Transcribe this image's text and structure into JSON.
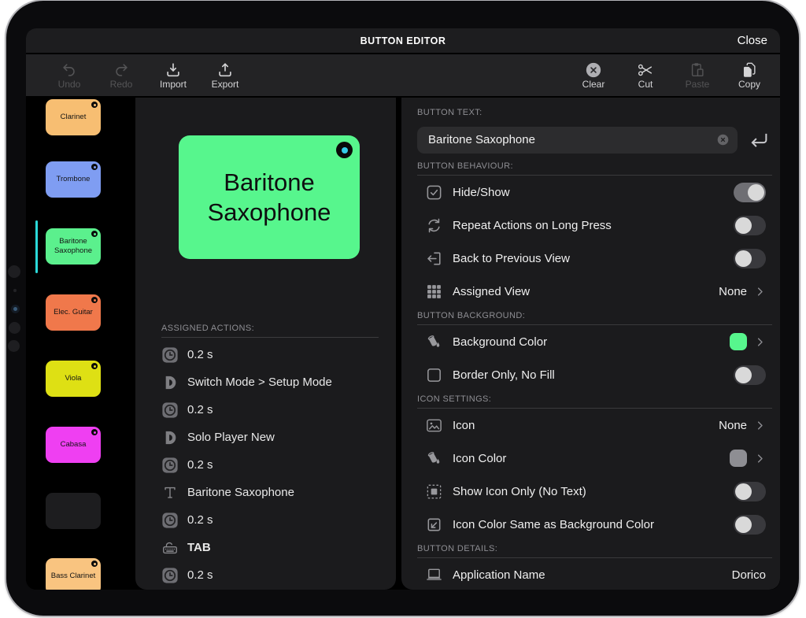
{
  "titlebar": {
    "title": "BUTTON EDITOR",
    "close_label": "Close"
  },
  "toolbar": {
    "left": [
      {
        "label": "Undo",
        "icon": "undo-icon",
        "enabled": false
      },
      {
        "label": "Redo",
        "icon": "redo-icon",
        "enabled": false
      },
      {
        "label": "Import",
        "icon": "import-icon",
        "enabled": true
      },
      {
        "label": "Export",
        "icon": "export-icon",
        "enabled": true
      }
    ],
    "right": [
      {
        "label": "Clear",
        "icon": "clear-icon",
        "enabled": true
      },
      {
        "label": "Cut",
        "icon": "cut-icon",
        "enabled": true
      },
      {
        "label": "Paste",
        "icon": "paste-icon",
        "enabled": false
      },
      {
        "label": "Copy",
        "icon": "copy-icon",
        "enabled": true
      }
    ]
  },
  "sidebar": {
    "selection_color": "#2BD9D9",
    "buttons": [
      {
        "label": "Clarinet",
        "color": "#F7BE72"
      },
      {
        "label": "Trombone",
        "color": "#7F9DF2"
      },
      {
        "label": "Baritone Saxophone",
        "color": "#5BF08D",
        "selected": true
      },
      {
        "label": "Elec. Guitar",
        "color": "#F0784B"
      },
      {
        "label": "Viola",
        "color": "#DEE014"
      },
      {
        "label": "Cabasa",
        "color": "#EF3FF2"
      },
      {
        "label": "",
        "color": "#1D1D1F",
        "blank": true
      },
      {
        "label": "Bass Clarinet",
        "color": "#F9C480"
      }
    ]
  },
  "preview": {
    "label": "Baritone Saxophone",
    "color": "#57F68D",
    "indicator_color": "#35CBE8"
  },
  "actions": {
    "header": "ASSIGNED ACTIONS:",
    "items": [
      {
        "icon": "clock-icon",
        "label": "0.2 s"
      },
      {
        "icon": "dorico-icon",
        "label": "Switch Mode > Setup Mode"
      },
      {
        "icon": "clock-icon",
        "label": "0.2 s"
      },
      {
        "icon": "dorico-icon",
        "label": "Solo Player New"
      },
      {
        "icon": "clock-icon",
        "label": "0.2 s"
      },
      {
        "icon": "text-icon",
        "label": "Baritone Saxophone"
      },
      {
        "icon": "clock-icon",
        "label": "0.2 s"
      },
      {
        "icon": "keyboard-icon",
        "label": "TAB",
        "emphasis": true
      },
      {
        "icon": "clock-icon",
        "label": "0.2 s"
      }
    ]
  },
  "inspector": {
    "button_text": {
      "header": "BUTTON TEXT:",
      "value": "Baritone Saxophone"
    },
    "sections": [
      {
        "header": "BUTTON BEHAVIOUR:",
        "rows": [
          {
            "icon": "checkbox-checked-icon",
            "label": "Hide/Show",
            "control": "toggle",
            "on": true
          },
          {
            "icon": "repeat-icon",
            "label": "Repeat Actions on Long Press",
            "control": "toggle",
            "on": false
          },
          {
            "icon": "back-arrow-icon",
            "label": "Back to Previous View",
            "control": "toggle",
            "on": false
          },
          {
            "icon": "grid-icon",
            "label": "Assigned View",
            "control": "value-chevron",
            "value": "None"
          }
        ]
      },
      {
        "header": "BUTTON BACKGROUND:",
        "rows": [
          {
            "icon": "paint-bucket-icon",
            "label": "Background Color",
            "control": "swatch-chevron",
            "swatch": "#57F68D"
          },
          {
            "icon": "square-outline-icon",
            "label": "Border Only, No Fill",
            "control": "toggle",
            "on": false
          }
        ]
      },
      {
        "header": "ICON SETTINGS:",
        "rows": [
          {
            "icon": "image-icon",
            "label": "Icon",
            "control": "value-chevron",
            "value": "None"
          },
          {
            "icon": "paint-bucket-icon",
            "label": "Icon Color",
            "control": "swatch-chevron",
            "swatch": "#8E8E93"
          },
          {
            "icon": "icon-only-icon",
            "label": "Show Icon Only (No Text)",
            "control": "toggle",
            "on": false
          },
          {
            "icon": "arrow-into-corner-icon",
            "label": "Icon Color Same as Background Color",
            "control": "toggle",
            "on": false
          }
        ]
      },
      {
        "header": "BUTTON DETAILS:",
        "rows": [
          {
            "icon": "laptop-icon",
            "label": "Application Name",
            "control": "value",
            "value": "Dorico"
          }
        ]
      }
    ]
  }
}
